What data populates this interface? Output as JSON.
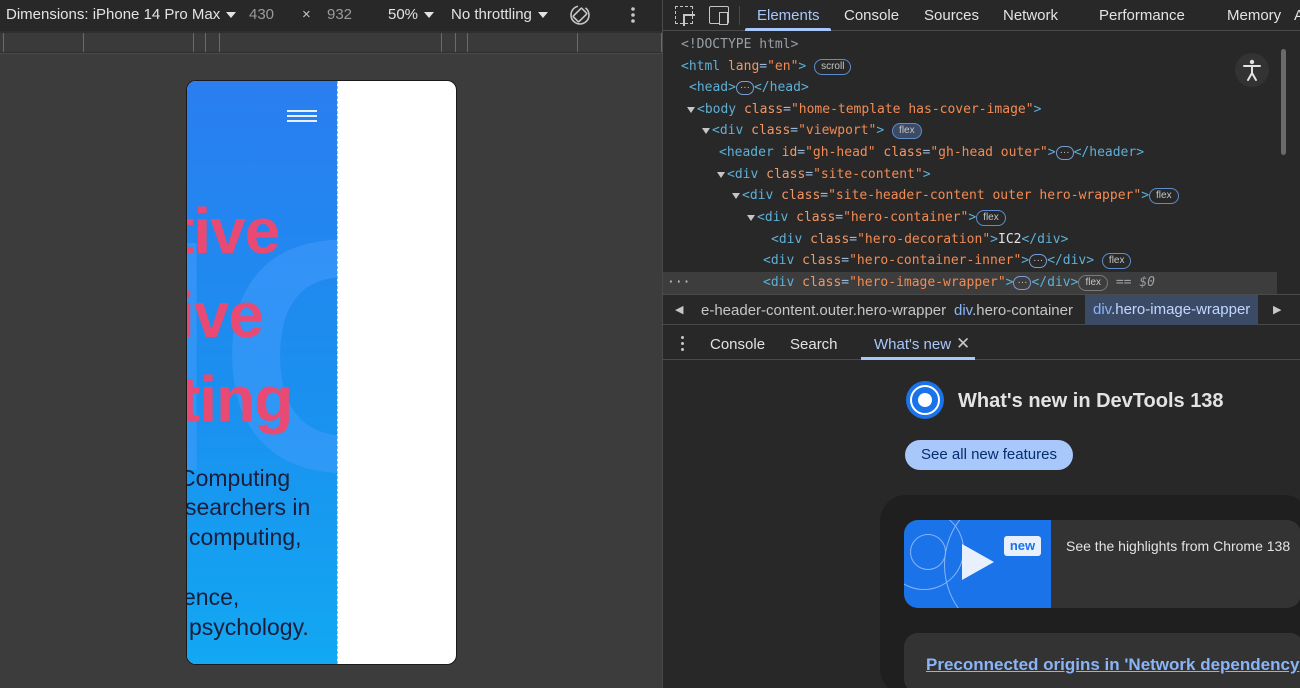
{
  "device_toolbar": {
    "dimensions_label": "Dimensions: iPhone 14 Pro Max",
    "width": "430",
    "times": "×",
    "height": "932",
    "zoom": "50%",
    "throttling": "No throttling"
  },
  "device_page": {
    "hero_words": [
      "tive",
      "ive",
      "ting"
    ],
    "hero_decoration": "IC2",
    "paragraph": [
      "Computing",
      "searchers in",
      "computing,",
      "ence,",
      "psychology."
    ]
  },
  "devtools": {
    "tabs": [
      "Elements",
      "Console",
      "Sources",
      "Network",
      "Performance",
      "Memory",
      "Ap"
    ],
    "active_tab": "Elements",
    "dom": {
      "doctype": "<!DOCTYPE html>",
      "html_tag": "html",
      "html_attr_name": "lang",
      "html_attr_value": "\"en\"",
      "html_badge": "scroll",
      "head_tag": "head",
      "body_tag": "body",
      "body_class": "\"home-template has-cover-image\"",
      "viewport_class": "\"viewport\"",
      "viewport_badge": "flex",
      "header_id": "\"gh-head\"",
      "header_class": "\"gh-head outer\"",
      "site_content_class": "\"site-content\"",
      "site_header_class": "\"site-header-content outer hero-wrapper\"",
      "site_header_badge": "flex",
      "hero_container_class": "\"hero-container\"",
      "hero_container_badge": "flex",
      "hero_decoration_class": "\"hero-decoration\"",
      "hero_decoration_text": "IC2",
      "hero_inner_class": "\"hero-container-inner\"",
      "hero_inner_badge": "flex",
      "hero_image_class": "\"hero-image-wrapper\"",
      "hero_image_badge": "flex",
      "selected_marker": "== $0"
    },
    "breadcrumbs": [
      "e-header-content.outer.hero-wrapper",
      "div.hero-container",
      "div.hero-image-wrapper"
    ],
    "breadcrumb_tags": [
      "div",
      "div"
    ],
    "breadcrumb_classes": [
      ".hero-container",
      ".hero-image-wrapper"
    ],
    "drawer_tabs": [
      "Console",
      "Search",
      "What's new"
    ],
    "active_drawer_tab": "What's new",
    "whats_new": {
      "title": "What's new in DevTools 138",
      "button": "See all new features",
      "badge": "new",
      "highlight_text": "See the highlights from Chrome 138",
      "link": "Preconnected origins in 'Network dependency"
    }
  },
  "colors": {
    "accent": "#a8c7fa",
    "hero_text": "#e84a73",
    "hero_bg": "#1a90ef"
  }
}
